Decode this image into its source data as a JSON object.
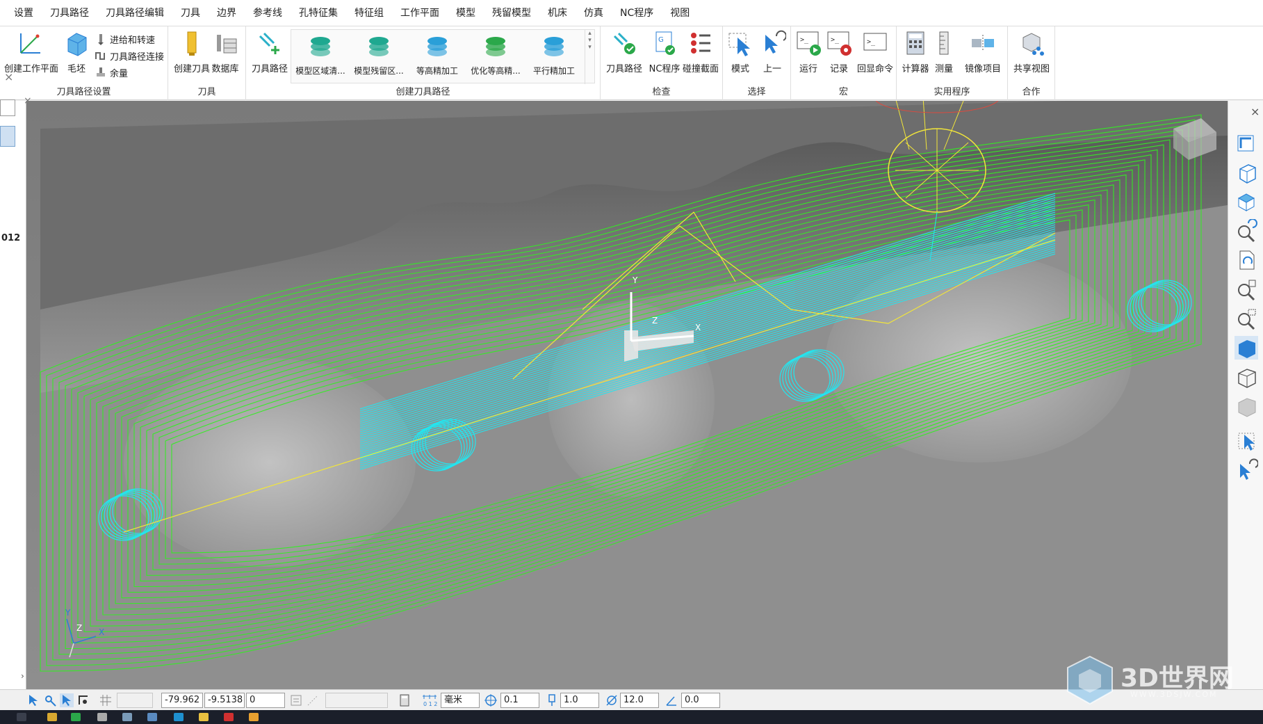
{
  "menu": [
    "设置",
    "刀具路径",
    "刀具路径编辑",
    "刀具",
    "边界",
    "参考线",
    "孔特征集",
    "特征组",
    "工作平面",
    "模型",
    "残留模型",
    "机床",
    "仿真",
    "NC程序",
    "视图"
  ],
  "ribbon": {
    "toolpath_setup": {
      "label": "刀具路径设置",
      "create_workplane": "创建工作平面",
      "stock": "毛坯",
      "feeds_speeds": "进给和转速",
      "connections": "刀具路径连接",
      "thickness": "余量"
    },
    "tool": {
      "label": "刀具",
      "create_tool": "创建刀具",
      "database": "数据库"
    },
    "create_toolpath": {
      "label": "创建刀具路径",
      "toolpath": "刀具路径",
      "gallery": [
        "模型区域清...",
        "模型残留区...",
        "等高精加工",
        "优化等高精...",
        "平行精加工"
      ]
    },
    "check": {
      "label": "检查",
      "toolpath": "刀具路径",
      "nc_program": "NC程序",
      "collision": "碰撞截面"
    },
    "select": {
      "label": "选择",
      "mode": "模式",
      "previous": "上一"
    },
    "macro": {
      "label": "宏",
      "run": "运行",
      "record": "记录",
      "echo": "回显命令"
    },
    "utilities": {
      "label": "实用程序",
      "calculator": "计算器",
      "measure": "测量",
      "mirror": "镜像项目"
    },
    "collab": {
      "label": "合作",
      "share_view": "共享视图"
    }
  },
  "left_panel": {
    "partial_text": "012"
  },
  "axis_labels": {
    "x": "X",
    "y": "Y",
    "z": "Z"
  },
  "statusbar": {
    "x": "-79.962",
    "y": "-9.5138",
    "z": "0",
    "units": "毫米",
    "tolerance": "0.1",
    "stepover": "1.0",
    "diameter": "12.0",
    "angle": "0.0"
  },
  "watermark": {
    "text": "3D世界网",
    "sub": "WWW.3DSJW.COM"
  },
  "colors": {
    "toolpath_green": "#33ee22",
    "toolpath_cyan": "#22e6f0",
    "tool_yellow": "#f2e63a",
    "model_gray": "#8c8c8c",
    "accent_blue": "#2a7fd4"
  }
}
